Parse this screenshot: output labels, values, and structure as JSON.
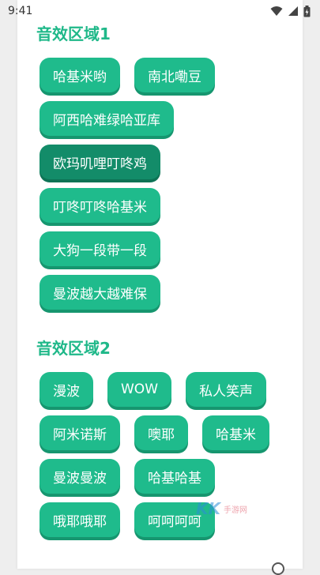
{
  "status": {
    "time": "9:41"
  },
  "section1": {
    "title": "音效区域1",
    "rows": [
      [
        "哈基米哟",
        "南北嘞豆"
      ],
      [
        "阿西哈难绿哈亚库"
      ],
      [
        "欧玛叽哩叮咚鸡"
      ],
      [
        "叮咚叮咚哈基米"
      ],
      [
        "大狗一段带一段"
      ],
      [
        "曼波越大越难保"
      ]
    ],
    "active": "欧玛叽哩叮咚鸡"
  },
  "section2": {
    "title": "音效区域2",
    "rows": [
      [
        "漫波",
        "WOW",
        "私人笑声"
      ],
      [
        "阿米诺斯",
        "噢耶",
        "哈基米"
      ],
      [
        "曼波曼波",
        "哈基哈基"
      ],
      [
        "哦耶哦耶",
        "呵呵呵呵"
      ]
    ]
  },
  "watermark": {
    "mark": "KK",
    "text": "手游网"
  },
  "colors": {
    "accent": "#1fbb8c",
    "accent_dark": "#16966f",
    "title": "#1fb889",
    "active": "#138c69"
  }
}
